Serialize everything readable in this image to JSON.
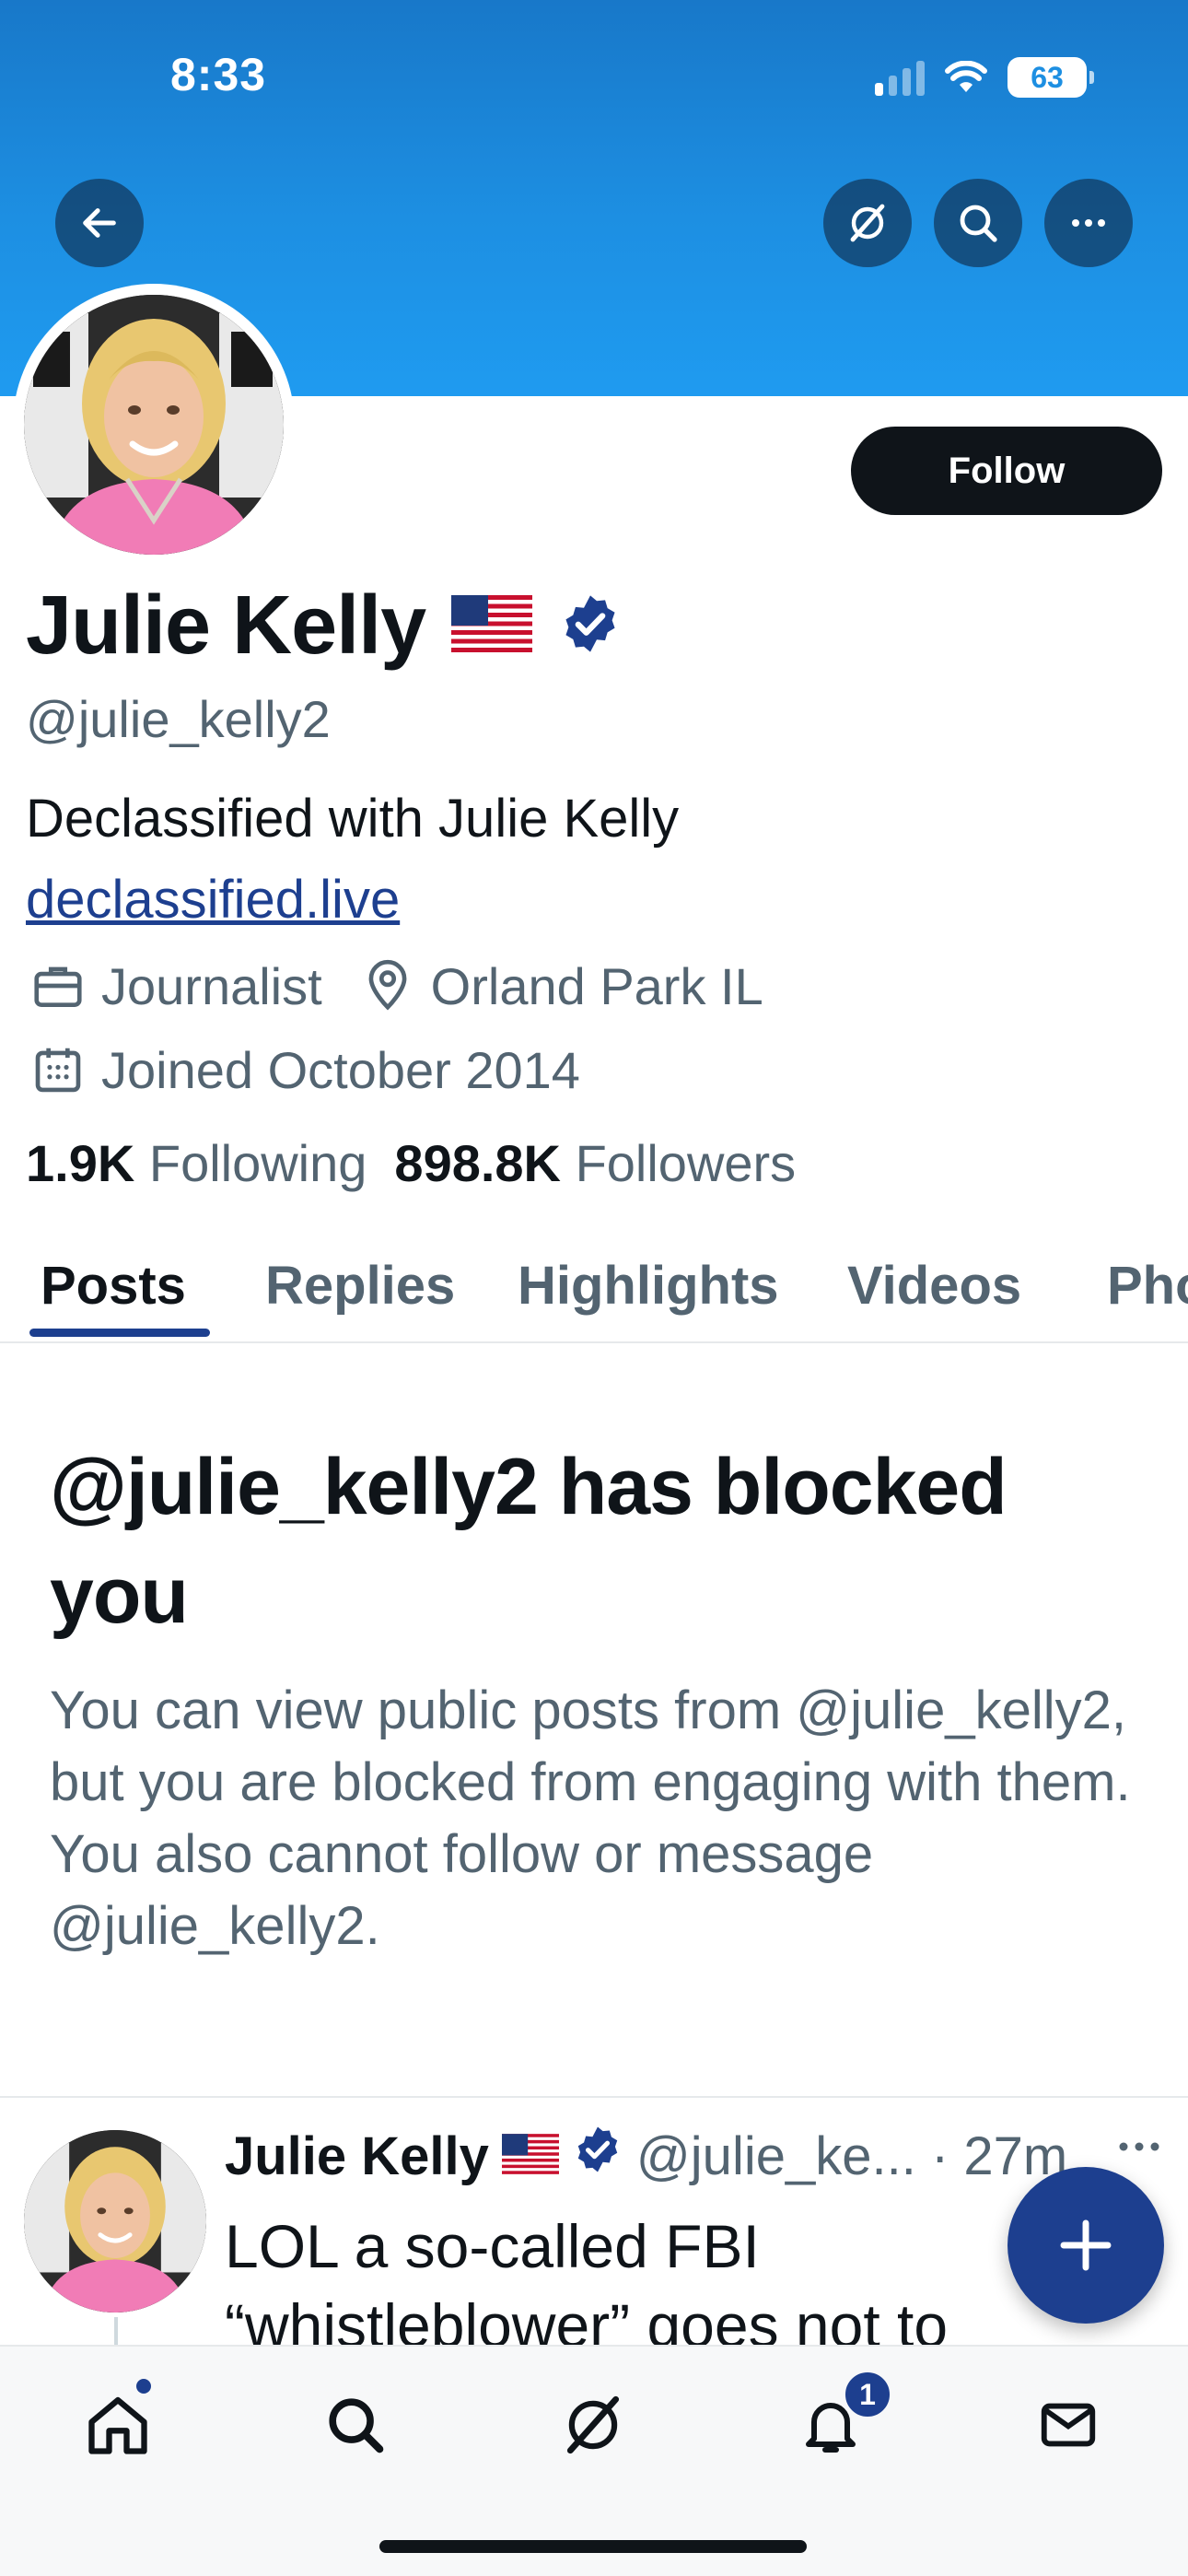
{
  "status_bar": {
    "time": "8:33",
    "battery": "63"
  },
  "profile": {
    "name": "Julie Kelly",
    "flag_emoji": "🇺🇸",
    "handle": "@julie_kelly2",
    "bio": "Declassified with Julie Kelly",
    "link": "declassified.live",
    "profession": "Journalist",
    "location": "Orland Park IL",
    "joined": "Joined October 2014",
    "following_count": "1.9K",
    "following_label": "Following",
    "followers_count": "898.8K",
    "followers_label": "Followers",
    "follow_button": "Follow"
  },
  "tabs": [
    "Posts",
    "Replies",
    "Highlights",
    "Videos",
    "Pho"
  ],
  "blocked": {
    "title": "@julie_kelly2 has blocked you",
    "message": "You can view public posts from @julie_kelly2, but you are blocked from engaging with them. You also cannot follow or message @julie_kelly2."
  },
  "post": {
    "author": "Julie Kelly",
    "flag_emoji": "🇺🇸",
    "handle_time": "@julie_ke... · 27m",
    "text": "LOL a so-called FBI “whistleblower” goes not to"
  },
  "bottom_nav": {
    "notification_count": "1"
  },
  "colors": {
    "accent": "#1d3f8f",
    "banner": "#1d8fe2",
    "text": "#0f1419",
    "muted": "#536471"
  }
}
